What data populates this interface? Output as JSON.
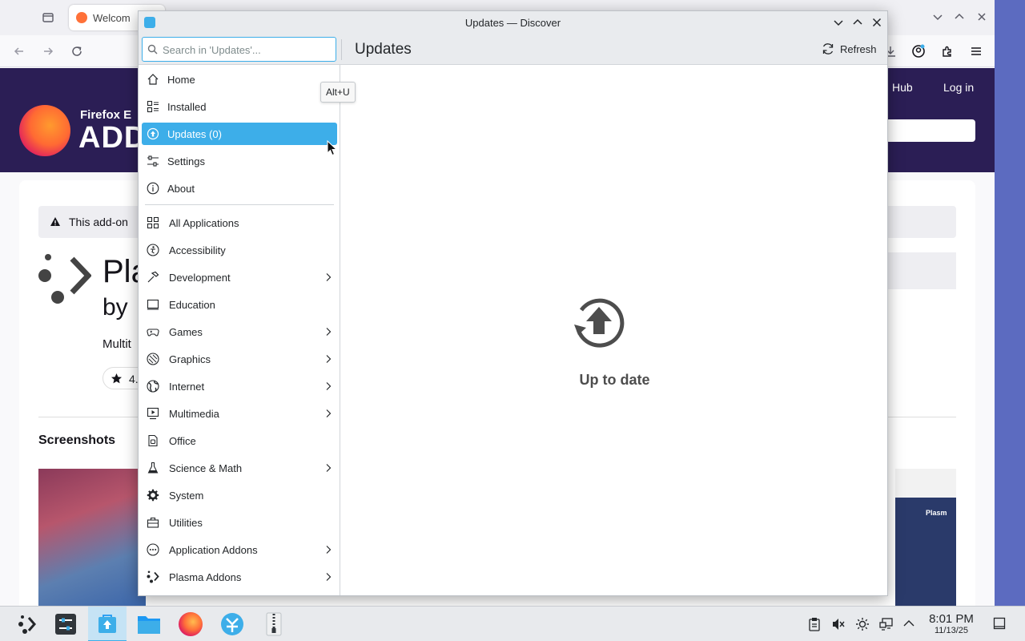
{
  "browser": {
    "tab_label": "Welcom",
    "hub_link": "Hub",
    "login": "Log in",
    "brand_small": "Firefox E",
    "brand_big": "ADD",
    "notice": "This add-on",
    "addon_name": "Pla",
    "addon_by": "by",
    "addon_desc": "Multit",
    "rating": "4.",
    "screenshots_heading": "Screenshots",
    "screenshot_caption": "Plasm"
  },
  "window": {
    "title": "Updates — Discover",
    "search_placeholder": "Search in 'Updates'...",
    "page_title": "Updates",
    "refresh_label": "Refresh"
  },
  "sidebar": {
    "nav": [
      {
        "label": "Home",
        "icon": "home-icon"
      },
      {
        "label": "Installed",
        "icon": "installed-icon"
      },
      {
        "label": "Updates (0)",
        "icon": "updates-icon",
        "selected": true
      },
      {
        "label": "Settings",
        "icon": "settings-icon"
      },
      {
        "label": "About",
        "icon": "info-icon"
      }
    ],
    "categories": [
      {
        "label": "All Applications",
        "icon": "grid-icon",
        "submenu": false
      },
      {
        "label": "Accessibility",
        "icon": "accessibility-icon",
        "submenu": false
      },
      {
        "label": "Development",
        "icon": "hammer-icon",
        "submenu": true
      },
      {
        "label": "Education",
        "icon": "education-icon",
        "submenu": false
      },
      {
        "label": "Games",
        "icon": "gamepad-icon",
        "submenu": true
      },
      {
        "label": "Graphics",
        "icon": "palette-icon",
        "submenu": true
      },
      {
        "label": "Internet",
        "icon": "globe-icon",
        "submenu": true
      },
      {
        "label": "Multimedia",
        "icon": "multimedia-icon",
        "submenu": true
      },
      {
        "label": "Office",
        "icon": "office-icon",
        "submenu": false
      },
      {
        "label": "Science & Math",
        "icon": "flask-icon",
        "submenu": true
      },
      {
        "label": "System",
        "icon": "gear-icon",
        "submenu": false
      },
      {
        "label": "Utilities",
        "icon": "toolbox-icon",
        "submenu": false
      },
      {
        "label": "Application Addons",
        "icon": "addons-icon",
        "submenu": true
      },
      {
        "label": "Plasma Addons",
        "icon": "plasma-icon",
        "submenu": true
      }
    ]
  },
  "main": {
    "status": "Up to date"
  },
  "tooltip": "Alt+U",
  "taskbar": {
    "time": "8:01 PM",
    "date": "11/13/25",
    "apps": [
      "system-settings",
      "discover",
      "file-manager",
      "firefox",
      "kde-connect",
      "archiver"
    ]
  },
  "colors": {
    "accent": "#3daee9",
    "hero": "#2b1e55",
    "desktop": "#5c6bc0"
  }
}
